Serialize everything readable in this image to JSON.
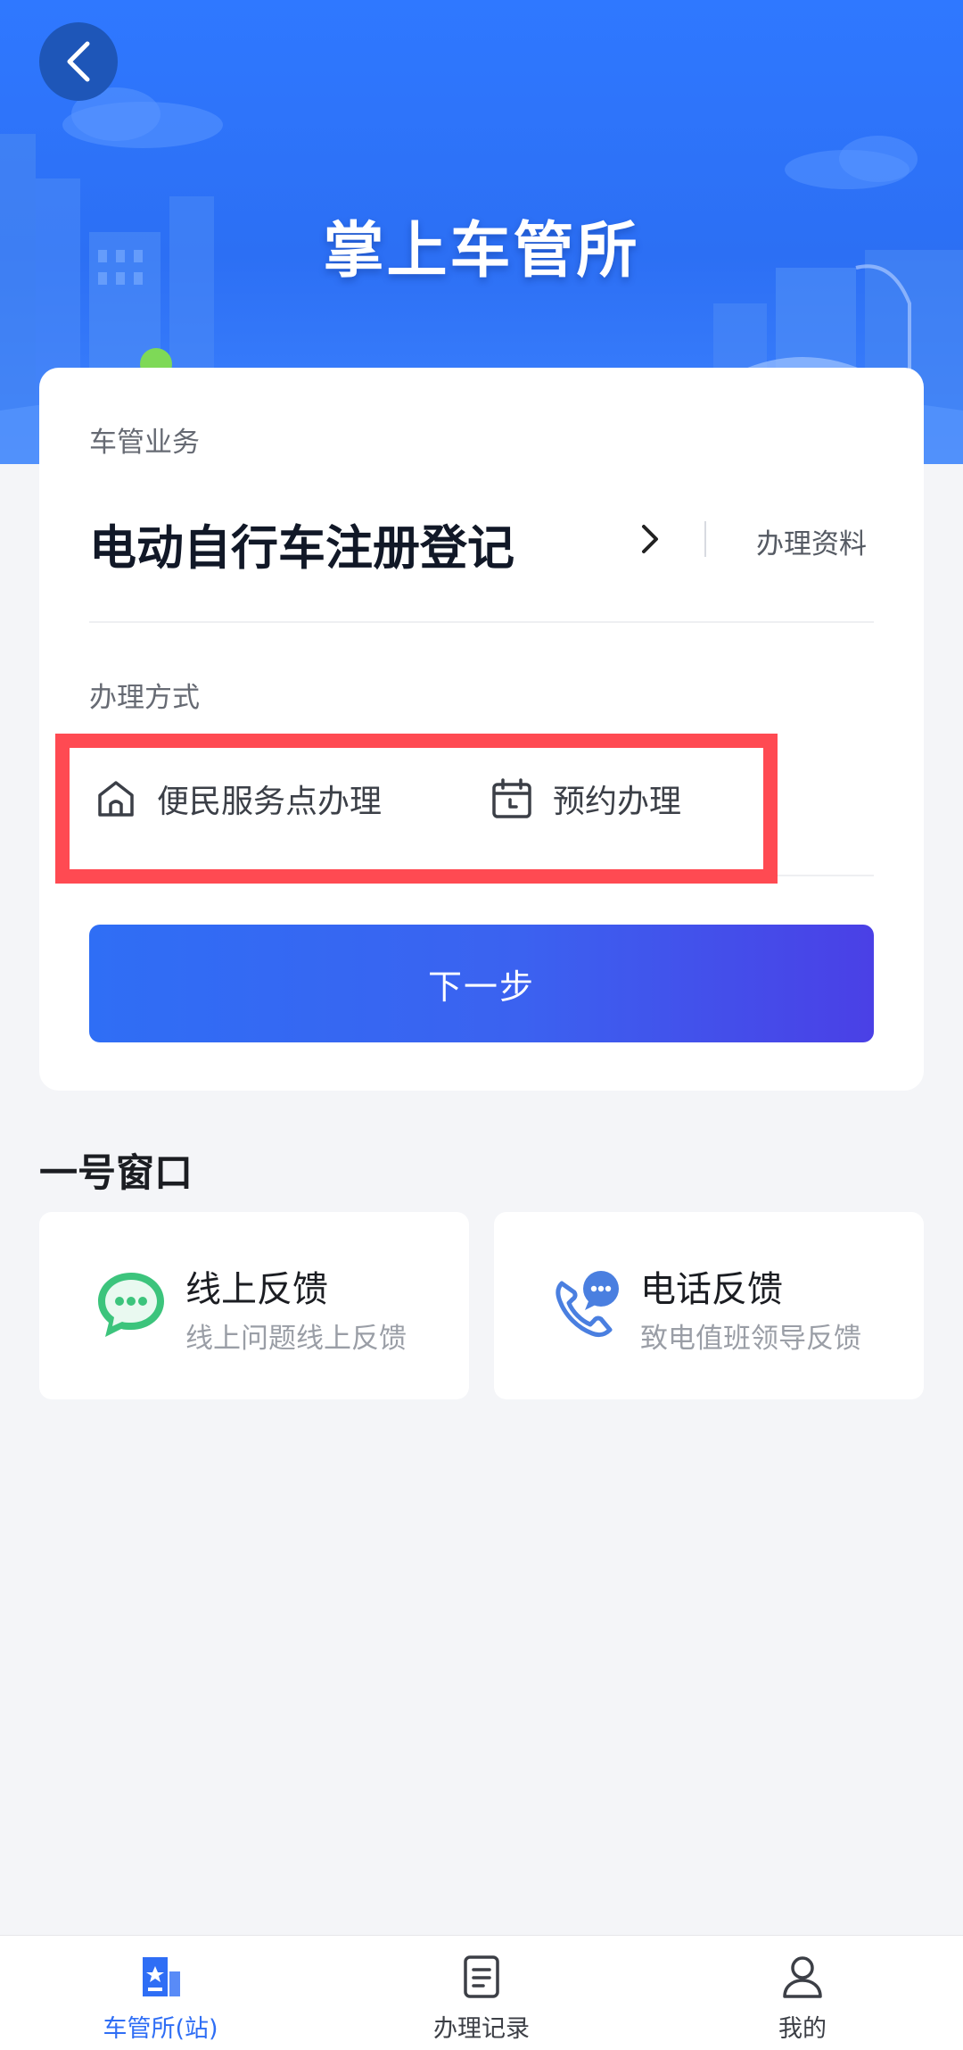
{
  "header": {
    "title": "掌上车管所"
  },
  "card": {
    "business_label": "车管业务",
    "service_name": "电动自行车注册登记",
    "materials_link": "办理资料",
    "method_label": "办理方式",
    "methods": [
      {
        "label": "便民服务点办理",
        "icon": "home-icon"
      },
      {
        "label": "预约办理",
        "icon": "calendar-clock-icon"
      }
    ],
    "next_button": "下一步"
  },
  "window_section": {
    "title": "一号窗口",
    "items": [
      {
        "title": "线上反馈",
        "subtitle": "线上问题线上反馈",
        "icon": "chat-bubble-icon"
      },
      {
        "title": "电话反馈",
        "subtitle": "致电值班领导反馈",
        "icon": "phone-chat-icon"
      }
    ]
  },
  "bottom_nav": {
    "items": [
      {
        "label": "车管所(站)",
        "icon": "station-icon",
        "active": true
      },
      {
        "label": "办理记录",
        "icon": "record-icon",
        "active": false
      },
      {
        "label": "我的",
        "icon": "user-icon",
        "active": false
      }
    ]
  },
  "colors": {
    "primary": "#2f6ef5",
    "highlight": "#ff4a52",
    "green": "#3cc47c",
    "blue_icon": "#4a7fe0"
  }
}
